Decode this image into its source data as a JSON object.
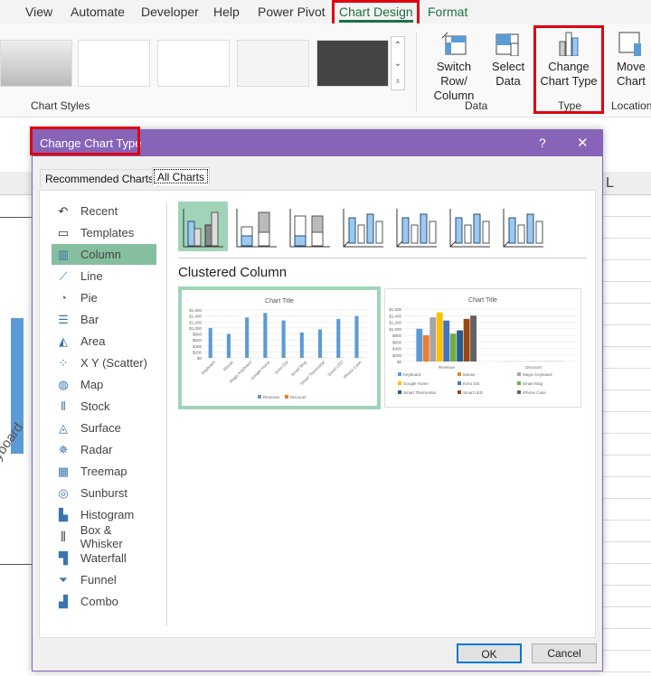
{
  "ribbon": {
    "tabs": [
      "View",
      "Automate",
      "Developer",
      "Help",
      "Power Pivot",
      "Chart Design",
      "Format"
    ],
    "active_tab": "Chart Design",
    "groups": {
      "chart_styles": "Chart Styles",
      "data": "Data",
      "type": "Type",
      "location": "Location"
    },
    "buttons": {
      "switch_row_col": [
        "Switch Row/",
        "Column"
      ],
      "select_data": [
        "Select",
        "Data"
      ],
      "change_chart_type": [
        "Change",
        "Chart Type"
      ],
      "move_chart": [
        "Move",
        "Chart"
      ]
    }
  },
  "sheet": {
    "column_header": "L",
    "cell_text": "yboard"
  },
  "dialog": {
    "title": "Change Chart Type",
    "help": "?",
    "close": "✕",
    "tabs": [
      "Recommended Charts",
      "All Charts"
    ],
    "active_tab": "All Charts",
    "chart_types": [
      {
        "label": "Recent",
        "icon": "undo-icon"
      },
      {
        "label": "Templates",
        "icon": "folder-icon"
      },
      {
        "label": "Column",
        "icon": "column-chart-icon"
      },
      {
        "label": "Line",
        "icon": "line-chart-icon"
      },
      {
        "label": "Pie",
        "icon": "pie-chart-icon"
      },
      {
        "label": "Bar",
        "icon": "bar-chart-icon"
      },
      {
        "label": "Area",
        "icon": "area-chart-icon"
      },
      {
        "label": "X Y (Scatter)",
        "icon": "scatter-chart-icon"
      },
      {
        "label": "Map",
        "icon": "map-icon"
      },
      {
        "label": "Stock",
        "icon": "stock-chart-icon"
      },
      {
        "label": "Surface",
        "icon": "surface-chart-icon"
      },
      {
        "label": "Radar",
        "icon": "radar-chart-icon"
      },
      {
        "label": "Treemap",
        "icon": "treemap-icon"
      },
      {
        "label": "Sunburst",
        "icon": "sunburst-icon"
      },
      {
        "label": "Histogram",
        "icon": "histogram-icon"
      },
      {
        "label": "Box & Whisker",
        "icon": "box-whisker-icon"
      },
      {
        "label": "Waterfall",
        "icon": "waterfall-icon"
      },
      {
        "label": "Funnel",
        "icon": "funnel-icon"
      },
      {
        "label": "Combo",
        "icon": "combo-chart-icon"
      }
    ],
    "selected_type": "Column",
    "subtype_title": "Clustered Column",
    "ok": "OK",
    "cancel": "Cancel"
  },
  "chart_data": [
    {
      "type": "bar",
      "title": "Chart Title",
      "categories": [
        "Keyboard",
        "Mouse",
        "Magic Keyboard",
        "Google Home",
        "Echo Dot",
        "Smart Mug",
        "Smart Thermostat",
        "Smart LED",
        "iPhone Case"
      ],
      "series": [
        {
          "name": "Revenue",
          "values": [
            1000,
            800,
            1350,
            1500,
            1250,
            850,
            950,
            1300,
            1400
          ],
          "color": "#5b9bd5"
        },
        {
          "name": "Discount",
          "values": [
            5,
            5,
            5,
            5,
            5,
            5,
            5,
            5,
            5
          ],
          "color": "#ed7d31"
        }
      ],
      "ylim": [
        0,
        1600
      ],
      "yticks": [
        "$0",
        "$200",
        "$400",
        "$600",
        "$800",
        "$1,000",
        "$1,200",
        "$1,400",
        "$1,600"
      ],
      "grid": true,
      "legend": "bottom"
    },
    {
      "type": "bar",
      "title": "Chart Title",
      "categories": [
        "Revenue",
        "Discount"
      ],
      "series": [
        {
          "name": "Keyboard",
          "values": [
            1000,
            5
          ],
          "color": "#5b9bd5"
        },
        {
          "name": "Mouse",
          "values": [
            800,
            5
          ],
          "color": "#ed7d31"
        },
        {
          "name": "Magic Keyboard",
          "values": [
            1350,
            5
          ],
          "color": "#a5a5a5"
        },
        {
          "name": "Google Home",
          "values": [
            1500,
            5
          ],
          "color": "#ffc000"
        },
        {
          "name": "Echo Dot",
          "values": [
            1250,
            5
          ],
          "color": "#4472c4"
        },
        {
          "name": "Smart Mug",
          "values": [
            850,
            5
          ],
          "color": "#70ad47"
        },
        {
          "name": "Smart Thermostat",
          "values": [
            950,
            5
          ],
          "color": "#255e91"
        },
        {
          "name": "Smart LED",
          "values": [
            1300,
            5
          ],
          "color": "#9e480e"
        },
        {
          "name": "iPhone Case",
          "values": [
            1400,
            5
          ],
          "color": "#636363"
        }
      ],
      "ylim": [
        0,
        1600
      ],
      "yticks": [
        "$0",
        "$200",
        "$400",
        "$600",
        "$800",
        "$1,000",
        "$1,200",
        "$1,400",
        "$1,600"
      ],
      "grid": true,
      "legend": "bottom"
    }
  ]
}
